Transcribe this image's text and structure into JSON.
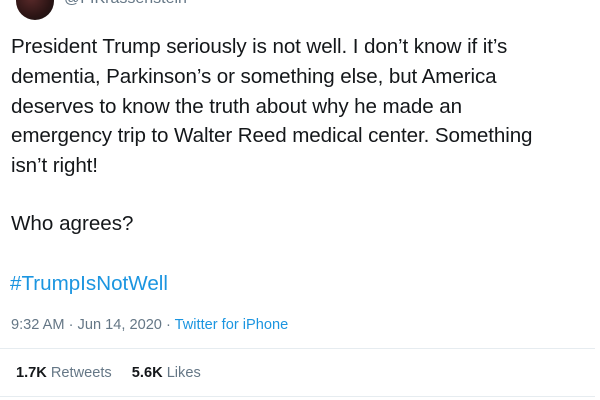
{
  "user": {
    "handle": "@FIKrassenstein"
  },
  "tweet": {
    "text": "President Trump seriously is not well.  I don’t know if it’s\ndementia, Parkinson’s or something else, but America\ndeserves to know the truth about why he made an\nemergency trip to Walter Reed medical center. Something\nisn’t right!",
    "question": "Who agrees?",
    "hashtag": "#TrumpIsNotWell"
  },
  "meta": {
    "time": "9:32 AM",
    "sep1": " · ",
    "date": "Jun 14, 2020",
    "sep2": " · ",
    "source": "Twitter for iPhone"
  },
  "stats": {
    "retweets_count": "1.7K",
    "retweets_label": "Retweets",
    "likes_count": "5.6K",
    "likes_label": "Likes"
  },
  "colors": {
    "link": "#1b95e0",
    "muted": "#657786",
    "text": "#14171a",
    "divider": "#e6ecf0"
  }
}
